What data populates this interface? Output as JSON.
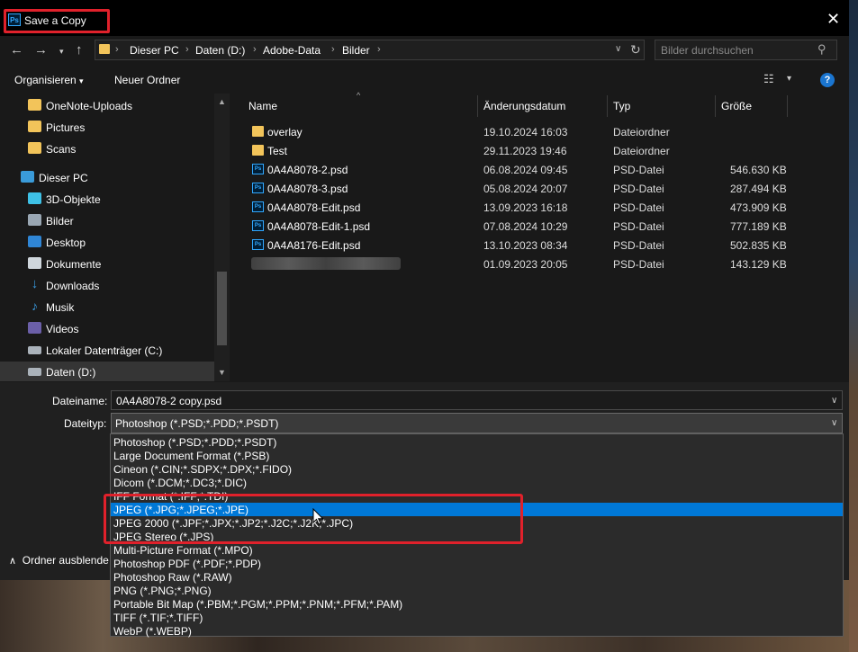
{
  "window": {
    "title": "Save a Copy",
    "app_icon_text": "Ps"
  },
  "address": {
    "crumbs": [
      "Dieser PC",
      "Daten (D:)",
      "Adobe-Data",
      "Bilder"
    ],
    "search_placeholder": "Bilder durchsuchen"
  },
  "toolbar": {
    "organize": "Organisieren",
    "new_folder": "Neuer Ordner"
  },
  "nav": {
    "items": [
      {
        "label": "OneNote-Uploads",
        "icon": "folder-user-icon"
      },
      {
        "label": "Pictures",
        "icon": "folder-user-icon"
      },
      {
        "label": "Scans",
        "icon": "folder-user-icon"
      },
      {
        "label": "Dieser PC",
        "icon": "computer-icon"
      },
      {
        "label": "3D-Objekte",
        "icon": "3d-objects-icon"
      },
      {
        "label": "Bilder",
        "icon": "pictures-icon"
      },
      {
        "label": "Desktop",
        "icon": "desktop-icon"
      },
      {
        "label": "Dokumente",
        "icon": "documents-icon"
      },
      {
        "label": "Downloads",
        "icon": "download-icon"
      },
      {
        "label": "Musik",
        "icon": "music-icon"
      },
      {
        "label": "Videos",
        "icon": "videos-icon"
      },
      {
        "label": "Lokaler Datenträger (C:)",
        "icon": "drive-icon"
      },
      {
        "label": "Daten (D:)",
        "icon": "drive-icon"
      }
    ]
  },
  "columns": {
    "name": "Name",
    "date": "Änderungsdatum",
    "type": "Typ",
    "size": "Größe"
  },
  "files": [
    {
      "name": "overlay",
      "date": "19.10.2024 16:03",
      "type": "Dateiordner",
      "size": "",
      "icon": "folder-icon"
    },
    {
      "name": "Test",
      "date": "29.11.2023 19:46",
      "type": "Dateiordner",
      "size": "",
      "icon": "folder-icon"
    },
    {
      "name": "0A4A8078-2.psd",
      "date": "06.08.2024 09:45",
      "type": "PSD-Datei",
      "size": "546.630 KB",
      "icon": "psd-file-icon"
    },
    {
      "name": "0A4A8078-3.psd",
      "date": "05.08.2024 20:07",
      "type": "PSD-Datei",
      "size": "287.494 KB",
      "icon": "psd-file-icon"
    },
    {
      "name": "0A4A8078-Edit.psd",
      "date": "13.09.2023 16:18",
      "type": "PSD-Datei",
      "size": "473.909 KB",
      "icon": "psd-file-icon"
    },
    {
      "name": "0A4A8078-Edit-1.psd",
      "date": "07.08.2024 10:29",
      "type": "PSD-Datei",
      "size": "777.189 KB",
      "icon": "psd-file-icon"
    },
    {
      "name": "0A4A8176-Edit.psd",
      "date": "13.10.2023 08:34",
      "type": "PSD-Datei",
      "size": "502.835 KB",
      "icon": "psd-file-icon"
    },
    {
      "name": "",
      "date": "01.09.2023 20:05",
      "type": "PSD-Datei",
      "size": "143.129 KB",
      "icon": "psd-file-icon"
    }
  ],
  "form": {
    "filename_label": "Dateiname:",
    "filename_value": "0A4A8078-2 copy.psd",
    "filetype_label": "Dateityp:",
    "filetype_value": "Photoshop (*.PSD;*.PDD;*.PSDT)",
    "hide_folders": "Ordner ausblende"
  },
  "filetype_options": [
    "Photoshop (*.PSD;*.PDD;*.PSDT)",
    "Large Document Format (*.PSB)",
    "Cineon (*.CIN;*.SDPX;*.DPX;*.FIDO)",
    "Dicom (*.DCM;*.DC3;*.DIC)",
    "IFF Format (*.IFF;*.TDI)",
    "JPEG (*.JPG;*.JPEG;*.JPE)",
    "JPEG 2000 (*.JPF;*.JPX;*.JP2;*.J2C;*.J2K;*.JPC)",
    "JPEG Stereo (*.JPS)",
    "Multi-Picture Format (*.MPO)",
    "Photoshop PDF (*.PDF;*.PDP)",
    "Photoshop Raw (*.RAW)",
    "PNG (*.PNG;*.PNG)",
    "Portable Bit Map (*.PBM;*.PGM;*.PPM;*.PNM;*.PFM;*.PAM)",
    "TIFF (*.TIF;*.TIFF)",
    "WebP (*.WEBP)"
  ],
  "selected_option_index": 5,
  "colors": {
    "accent": "#0078d7",
    "highlight_box": "#e0212b",
    "folder": "#f2c45a"
  }
}
